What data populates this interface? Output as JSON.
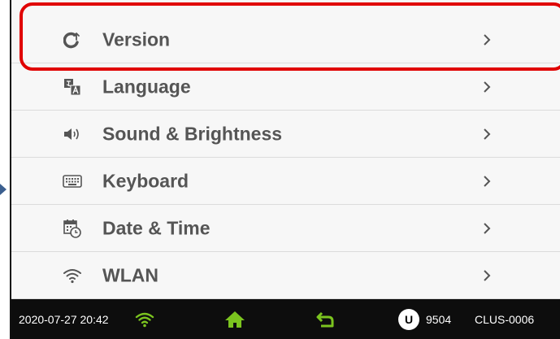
{
  "menu": {
    "items": [
      {
        "label": "Version",
        "icon": "version-icon"
      },
      {
        "label": "Language",
        "icon": "language-icon"
      },
      {
        "label": "Sound & Brightness",
        "icon": "speaker-icon"
      },
      {
        "label": "Keyboard",
        "icon": "keyboard-icon"
      },
      {
        "label": "Date & Time",
        "icon": "calendar-clock-icon"
      },
      {
        "label": "WLAN",
        "icon": "wifi-icon"
      }
    ]
  },
  "status_bar": {
    "datetime": "2020-07-27 20:42",
    "user_badge": "U",
    "user_count": "9504",
    "device_id": "CLUS-0006"
  },
  "colors": {
    "highlight": "#e00000",
    "accent_green": "#7bc41f",
    "label": "#555555",
    "status_bar_bg": "#0d0d0d"
  }
}
